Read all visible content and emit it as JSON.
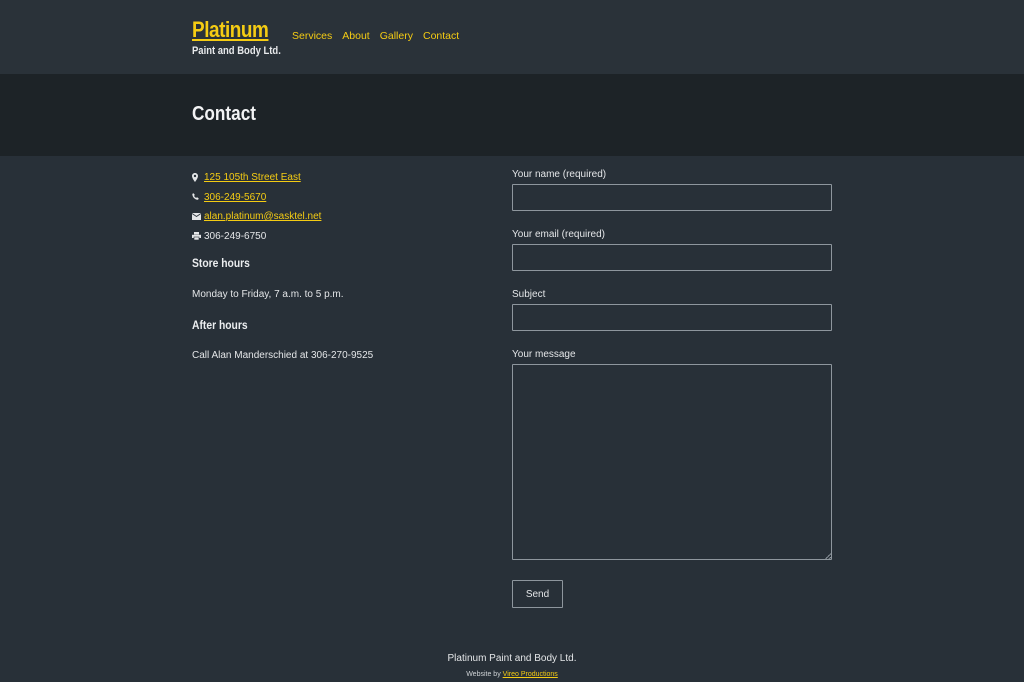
{
  "header": {
    "logo_title": "Platinum",
    "logo_subtitle": "Paint and Body Ltd.",
    "nav": [
      "Services",
      "About",
      "Gallery",
      "Contact"
    ]
  },
  "banner": {
    "title": "Contact"
  },
  "contact_info": {
    "address": "125 105th Street East",
    "phone": "306-249-5670",
    "email": "alan.platinum@sasktel.net",
    "fax": "306-249-6750",
    "icons": [
      "map-marker-icon",
      "phone-icon",
      "envelope-icon",
      "printer-icon"
    ]
  },
  "store_hours": {
    "heading": "Store hours",
    "text": "Monday to Friday, 7 a.m. to 5 p.m."
  },
  "after_hours": {
    "heading": "After hours",
    "text": "Call Alan Manderschied at 306-270-9525"
  },
  "form": {
    "name_label": "Your name (required)",
    "email_label": "Your email (required)",
    "subject_label": "Subject",
    "message_label": "Your message",
    "name_value": "",
    "email_value": "",
    "subject_value": "",
    "message_value": "",
    "send_label": "Send"
  },
  "footer": {
    "company": "Platinum Paint and Body Ltd.",
    "credit_prefix": "Website by",
    "credit_link": "Vireo Productions"
  },
  "colors": {
    "accent": "#f5cc13",
    "background": "#283038",
    "banner": "#1d2327"
  }
}
